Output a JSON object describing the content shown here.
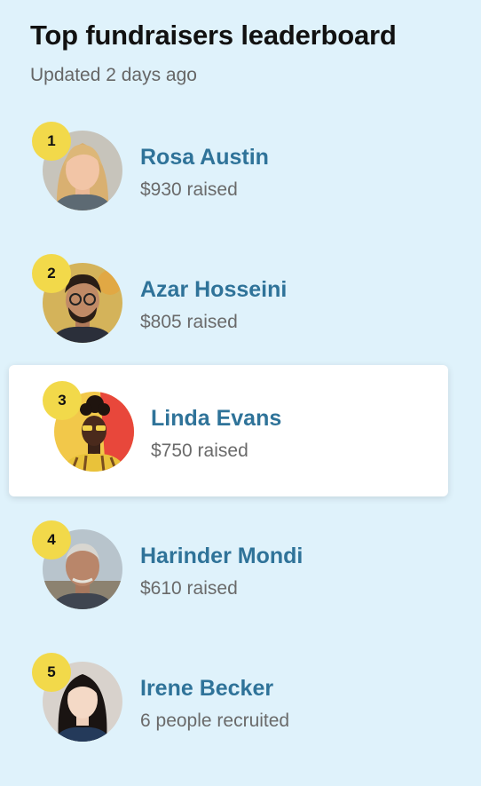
{
  "header": {
    "title": "Top fundraisers leaderboard",
    "subtitle": "Updated 2 days ago"
  },
  "colors": {
    "background": "#dff2fb",
    "name": "#2f7399",
    "badge": "#f2d94a",
    "highlight_card": "#ffffff"
  },
  "leaderboard": [
    {
      "rank": "1",
      "name": "Rosa Austin",
      "stat": "$930 raised",
      "highlighted": false
    },
    {
      "rank": "2",
      "name": "Azar Hosseini",
      "stat": "$805 raised",
      "highlighted": false
    },
    {
      "rank": "3",
      "name": "Linda Evans",
      "stat": "$750 raised",
      "highlighted": true
    },
    {
      "rank": "4",
      "name": "Harinder Mondi",
      "stat": "$610 raised",
      "highlighted": false
    },
    {
      "rank": "5",
      "name": "Irene Becker",
      "stat": "6 people recruited",
      "highlighted": false
    }
  ]
}
